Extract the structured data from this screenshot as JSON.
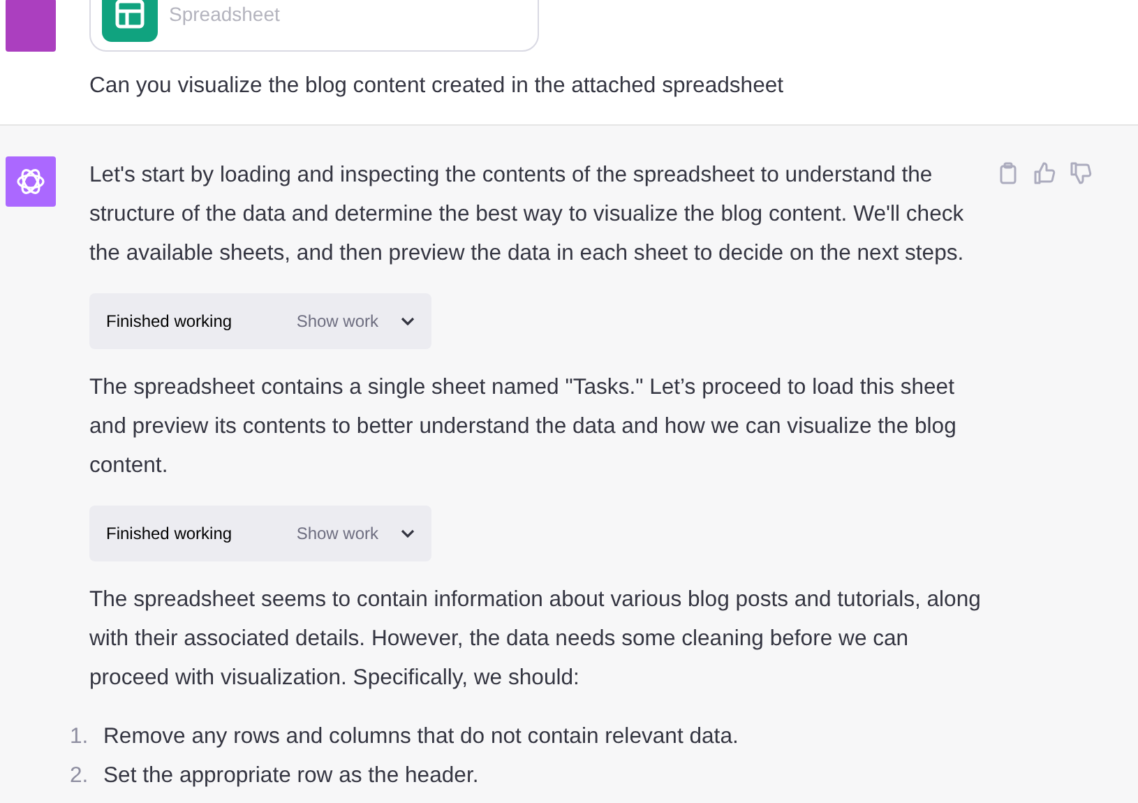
{
  "attachment": {
    "type_label": "Spreadsheet"
  },
  "user_message": "Can you visualize the blog content created in the attached spreadsheet",
  "assistant": {
    "blocks": [
      {
        "kind": "paragraph",
        "text": "Let's start by loading and inspecting the contents of the spreadsheet to understand the structure of the data and determine the best way to visualize the blog content. We'll check the available sheets, and then preview the data in each sheet to decide on the next steps."
      },
      {
        "kind": "work",
        "status": "Finished working",
        "toggle": "Show work",
        "expanded": false
      },
      {
        "kind": "paragraph",
        "text": "The spreadsheet contains a single sheet named \"Tasks.\" Let’s proceed to load this sheet and preview its contents to better understand the data and how we can visualize the blog content."
      },
      {
        "kind": "work",
        "status": "Finished working",
        "toggle": "Show work",
        "expanded": false
      },
      {
        "kind": "paragraph",
        "text": "The spreadsheet seems to contain information about various blog posts and tutorials, along with their associated details. However, the data needs some cleaning before we can proceed with visualization. Specifically, we should:"
      },
      {
        "kind": "list",
        "items": [
          {
            "number": "1.",
            "text": "Remove any rows and columns that do not contain relevant data."
          },
          {
            "number": "2.",
            "text": "Set the appropriate row as the header."
          }
        ]
      }
    ]
  }
}
